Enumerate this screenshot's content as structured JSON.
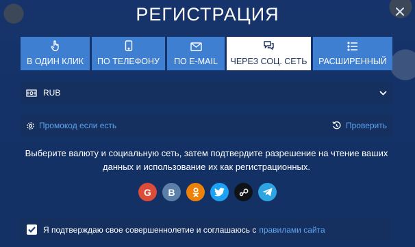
{
  "modal": {
    "title": "РЕГИСТРАЦИЯ"
  },
  "tabs": [
    {
      "label": "В ОДИН КЛИК",
      "icon": "pointer-hand-icon",
      "active": false
    },
    {
      "label": "ПО ТЕЛЕФОНУ",
      "icon": "phone-icon",
      "active": false
    },
    {
      "label": "ПО E-MAIL",
      "icon": "envelope-icon",
      "active": false
    },
    {
      "label": "ЧЕРЕЗ СОЦ. СЕТЬ",
      "icon": "chat-bubbles-icon",
      "active": true
    },
    {
      "label": "РАСШИРЕННЫЙ",
      "icon": "list-icon",
      "active": false
    }
  ],
  "currency": {
    "value": "RUB"
  },
  "promo": {
    "label": "Промокод если есть",
    "check_label": "Проверить"
  },
  "info_text": "Выберите валюту и социальную сеть, затем подтвердите разрешение на чтение ваших данных и использование их как регистрационных.",
  "social": [
    {
      "name": "google",
      "glyph": "G",
      "color": "#dd4b39"
    },
    {
      "name": "vkontakte",
      "glyph": "В",
      "color": "#5b7fa6"
    },
    {
      "name": "odnoklassniki",
      "glyph": "ok",
      "color": "#ee8208"
    },
    {
      "name": "twitter",
      "glyph": "tw",
      "color": "#1da1f2"
    },
    {
      "name": "steam",
      "glyph": "st",
      "color": "#0f1217"
    },
    {
      "name": "telegram",
      "glyph": "tg",
      "color": "#2ca5e0"
    }
  ],
  "agreement": {
    "checked": true,
    "text": "Я подтверждаю свое совершеннолетие и соглашаюсь с",
    "link": "правилами сайта"
  },
  "colors": {
    "tab_bg": "#3f7fd2",
    "field_bg": "#15305e",
    "link": "#5fa3ef"
  }
}
